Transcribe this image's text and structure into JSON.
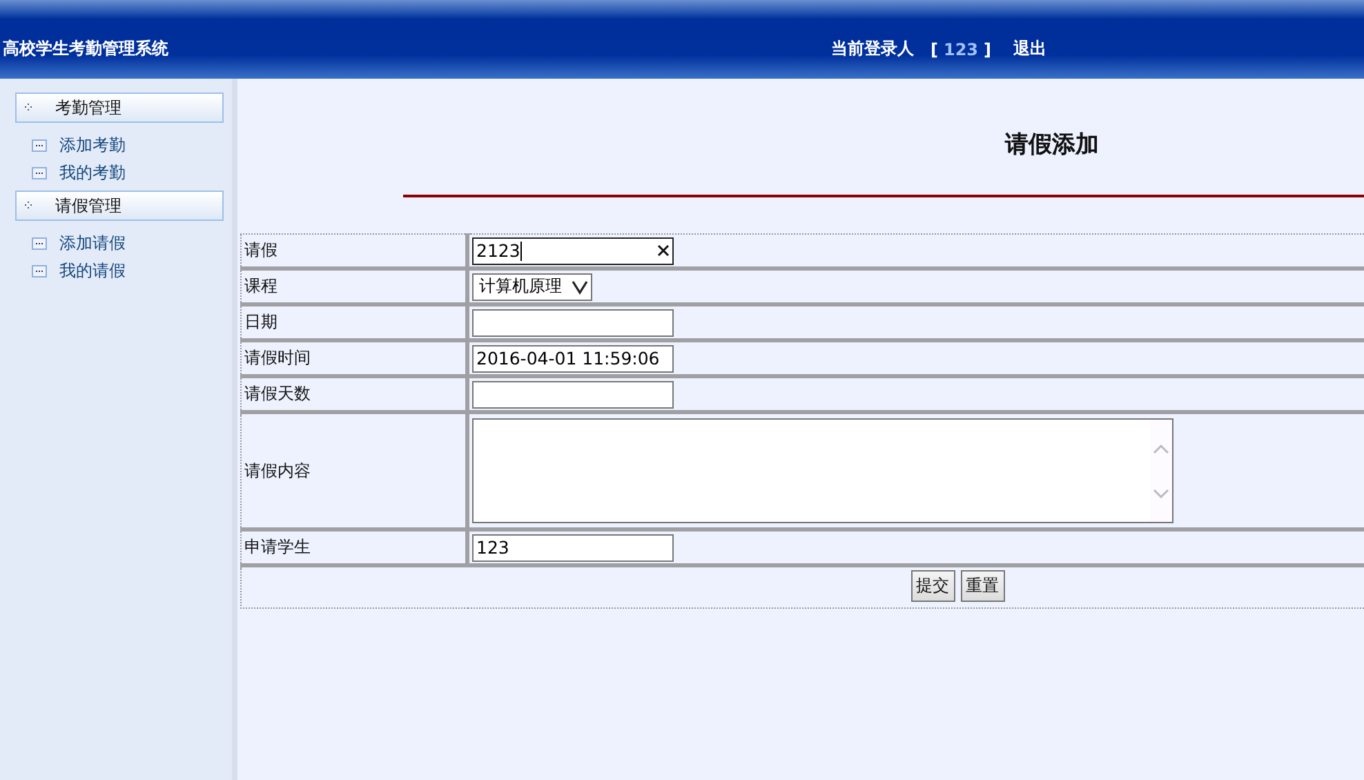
{
  "header": {
    "title": "高校学生考勤管理系统",
    "login_label": "当前登录人",
    "login_open": "[",
    "login_user": "123",
    "login_close": "]",
    "logout": "退出"
  },
  "sidebar": {
    "groups": [
      {
        "title": "考勤管理",
        "items": [
          "添加考勤",
          "我的考勤"
        ]
      },
      {
        "title": "请假管理",
        "items": [
          "添加请假",
          "我的请假"
        ]
      }
    ]
  },
  "page_title": "请假添加",
  "form": {
    "rows": [
      {
        "label": "请假",
        "kind": "text",
        "value": "2123",
        "focused": true
      },
      {
        "label": "课程",
        "kind": "select",
        "value": "计算机原理",
        "focused": false
      },
      {
        "label": "日期",
        "kind": "text",
        "value": "",
        "focused": false
      },
      {
        "label": "请假时间",
        "kind": "text",
        "value": "2016-04-01 11:59:06",
        "focused": false
      },
      {
        "label": "请假天数",
        "kind": "text",
        "value": "",
        "focused": false
      },
      {
        "label": "请假内容",
        "kind": "textarea",
        "value": "",
        "focused": false
      },
      {
        "label": "申请学生",
        "kind": "text",
        "value": "123",
        "focused": false
      }
    ],
    "buttons": [
      "提交",
      "重置"
    ]
  }
}
